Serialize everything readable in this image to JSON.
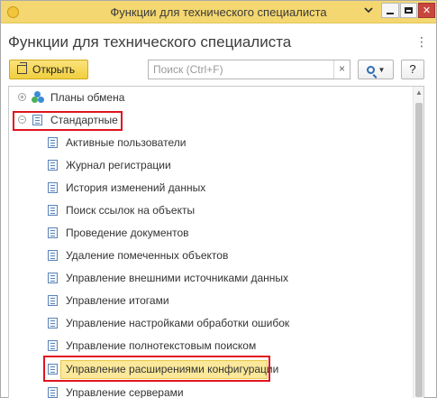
{
  "window": {
    "title": "Функции для технического специалиста",
    "menu_icon": "dropdown-menu-icon",
    "minimize_icon": "minimize-icon",
    "maximize_icon": "maximize-icon",
    "close_label": "✕"
  },
  "header": {
    "title": "Функции для технического специалиста",
    "more_label": "⋮"
  },
  "toolbar": {
    "open_label": "Открыть",
    "search_placeholder": "Поиск (Ctrl+F)",
    "search_value": "",
    "clear_label": "×",
    "help_label": "?"
  },
  "tree": {
    "groups": [
      {
        "label": "Планы обмена",
        "expander": "+",
        "icon": "exchange-plans-icon"
      },
      {
        "label": "Стандартные",
        "expander": "−",
        "icon": "document-icon"
      }
    ],
    "items": [
      {
        "label": "Активные пользователи"
      },
      {
        "label": "Журнал регистрации"
      },
      {
        "label": "История изменений данных"
      },
      {
        "label": "Поиск ссылок на объекты"
      },
      {
        "label": "Проведение документов"
      },
      {
        "label": "Удаление помеченных объектов"
      },
      {
        "label": "Управление внешними источниками данных"
      },
      {
        "label": "Управление итогами"
      },
      {
        "label": "Управление настройками обработки ошибок"
      },
      {
        "label": "Управление полнотекстовым поиском"
      },
      {
        "label": "Управление расширениями конфигурации"
      },
      {
        "label": "Управление серверами"
      }
    ],
    "selected_index": 10
  },
  "colors": {
    "titlebar": "#f4d770",
    "open_button": "#f1cf3f",
    "highlight_border": "#e0141c",
    "selected_row": "#fbe89a"
  }
}
